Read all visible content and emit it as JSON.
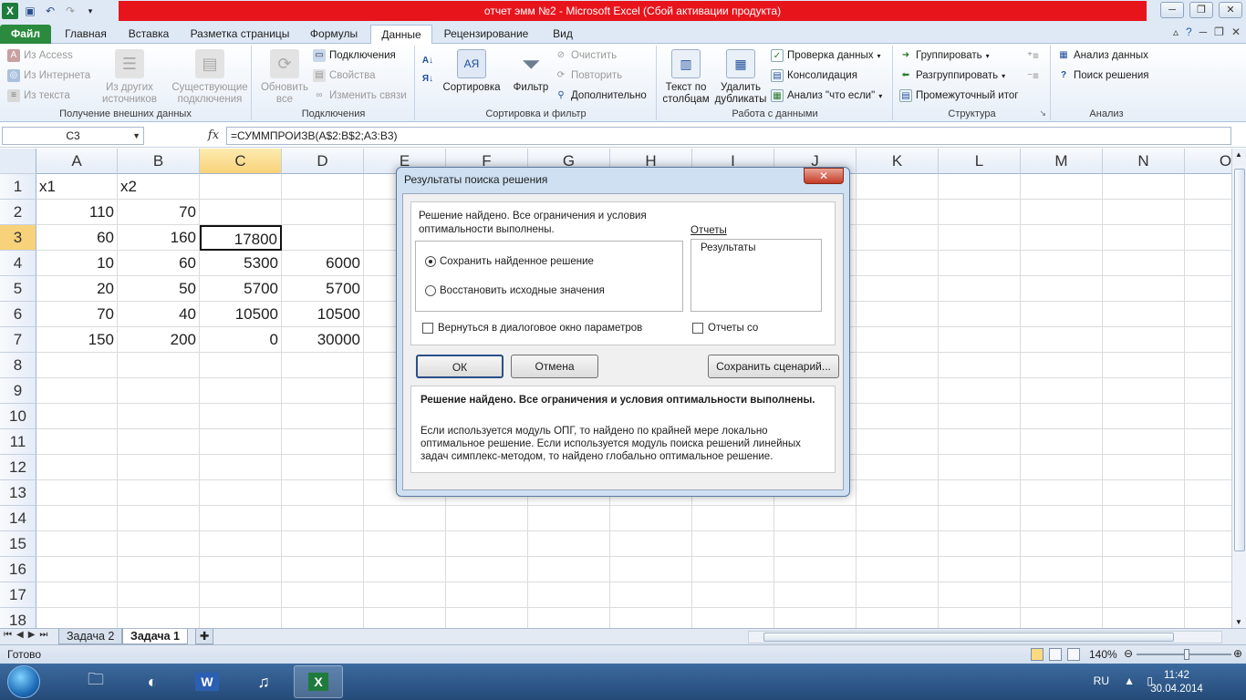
{
  "window": {
    "title": "отчет эмм №2  -  Microsoft Excel (Сбой активации продукта)"
  },
  "tabs": [
    "Файл",
    "Главная",
    "Вставка",
    "Разметка страницы",
    "Формулы",
    "Данные",
    "Рецензирование",
    "Вид"
  ],
  "active_tab": "Данные",
  "ribbon": {
    "get_external": {
      "access": "Из Access",
      "web": "Из Интернета",
      "text": "Из текста",
      "other_line1": "Из других",
      "other_line2": "источников",
      "existing_line1": "Существующие",
      "existing_line2": "подключения",
      "label": "Получение внешних данных"
    },
    "connections": {
      "refresh_line1": "Обновить",
      "refresh_line2": "все",
      "connections": "Подключения",
      "properties": "Свойства",
      "edit_links": "Изменить связи",
      "label": "Подключения"
    },
    "sort_filter": {
      "sort": "Сортировка",
      "filter": "Фильтр",
      "clear": "Очистить",
      "reapply": "Повторить",
      "advanced": "Дополнительно",
      "label": "Сортировка и фильтр"
    },
    "data_tools": {
      "text_to_cols_line1": "Текст по",
      "text_to_cols_line2": "столбцам",
      "remove_dup_line1": "Удалить",
      "remove_dup_line2": "дубликаты",
      "validation": "Проверка данных",
      "consolidate": "Консолидация",
      "what_if": "Анализ \"что если\"",
      "label": "Работа с данными"
    },
    "outline": {
      "group": "Группировать",
      "ungroup": "Разгруппировать",
      "subtotal": "Промежуточный итог",
      "label": "Структура"
    },
    "analysis": {
      "data_analysis": "Анализ данных",
      "solver": "Поиск решения",
      "label": "Анализ"
    }
  },
  "formula_bar": {
    "name_box": "C3",
    "fx": "fx",
    "formula": "=СУММПРОИЗВ(A$2:B$2;A3:B3)"
  },
  "columns": [
    "A",
    "B",
    "C",
    "D",
    "E",
    "F",
    "G",
    "H",
    "I",
    "J",
    "K",
    "L",
    "M",
    "N",
    "O"
  ],
  "rows": [
    "1",
    "2",
    "3",
    "4",
    "5",
    "6",
    "7",
    "8",
    "9",
    "10",
    "11",
    "12",
    "13",
    "14",
    "15",
    "16",
    "17",
    "18"
  ],
  "cells": {
    "r1": [
      "x1",
      "x2",
      "",
      ""
    ],
    "r2": [
      "110",
      "70",
      "",
      ""
    ],
    "r3": [
      "60",
      "160",
      "17800",
      ""
    ],
    "r4": [
      "10",
      "60",
      "5300",
      "6000"
    ],
    "r5": [
      "20",
      "50",
      "5700",
      "5700"
    ],
    "r6": [
      "70",
      "40",
      "10500",
      "10500"
    ],
    "r7": [
      "150",
      "200",
      "0",
      "30000"
    ]
  },
  "sheets": [
    "Задача 2",
    "Задача 1"
  ],
  "active_sheet": "Задача 1",
  "status": {
    "ready": "Готово",
    "zoom": "140%"
  },
  "taskbar": {
    "lang": "RU",
    "time": "11:42",
    "date": "30.04.2014"
  },
  "dialog": {
    "title": "Результаты поиска решения",
    "close": "✕",
    "found_text": "Решение найдено. Все ограничения и условия оптимальности выполнены.",
    "radio_keep": "Сохранить найденное решение",
    "radio_restore": "Восстановить исходные значения",
    "reports_label": "Отчеты",
    "reports_item": "Результаты",
    "check_return": "Вернуться в диалоговое окно параметров",
    "check_reports": "Отчеты со",
    "ok": "ОК",
    "cancel": "Отмена",
    "save_scenario": "Сохранить сценарий...",
    "bold_message": "Решение найдено. Все ограничения и условия оптимальности выполнены.",
    "info_message": "Если используется модуль ОПГ, то найдено по крайней мере локально оптимальное решение. Если используется модуль поиска решений линейных задач симплекс-методом, то найдено глобально оптимальное решение."
  }
}
